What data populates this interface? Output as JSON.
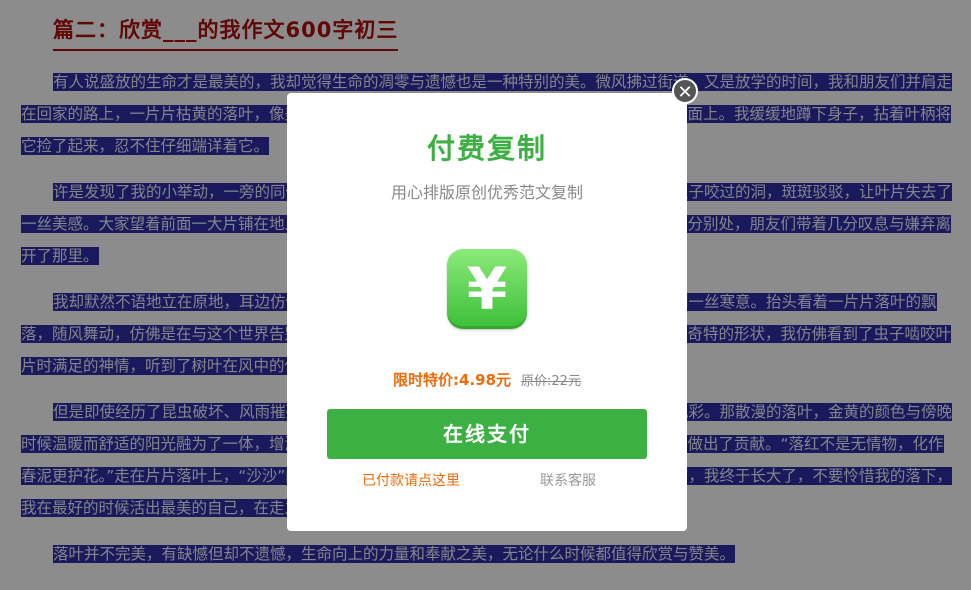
{
  "article": {
    "title": "篇二：欣赏___的我作文600字初三",
    "paragraphs": [
      "有人说盛放的生命才是最美的，我却觉得生命的凋零与遗憾也是一种特别的美。微风拂过街道，又是放学的时间，我和朋友们并肩走在回家的路上，一片片枯黄的落叶，像美丽的蝴蝶一样在空中翩翩起舞，然后轻轻地落在了我的鞋面上。我缓缓地蹲下身子，拈着叶柄将它捡了起来，忍不住仔细端详着它。",
      "许是发现了我的小举动，一旁的同伴们也纷纷凑了过来。只见叶片上布满了大大小小的、被虫子咬过的洞，斑斑驳驳，让叶片失去了一丝美感。大家望着前面一大片铺在地上的落叶，纷纷摇头叹息，说这些落叶真是太可惜了。走到分别处，朋友们带着几分叹息与嫌弃离开了那里。",
      "我却默然不语地立在原地，耳边仿佛又响起了秋风吹过的声音，带着几分凉意，让人不禁感到一丝寒意。抬头看着一片片落叶的飘落，随风舞动，仿佛是在与这个世界告别。我低下头，细细观察着手中的这片落叶，看着那些孔洞奇特的形状，我仿佛看到了虫子啮咬叶片时满足的神情，听到了树叶在风中的低语。",
      "但是即使经历了昆虫破坏、风雨摧残，它依然坚持着自己的使命，为大地带来了一抹别样的色彩。那散漫的落叶，金黄的颜色与傍晚时候温暖而舒适的阳光融为了一体，增添了一份秋天独有的韵味。它们用自己最后的生命为大自然做出了贡献。“落红不是无情物，化作春泥更护花。”走在片片落叶上，“沙沙”的声响仿佛是它们在对我说话，对我说：不要为我感到悲伤，我终于长大了，不要怜惜我的落下，我在最好的时候活出最美的自己，在走之前为这个世界留下了最后的美丽。",
      "落叶并不完美，有缺憾但却不遗憾，生命向上的力量和奉献之美，无论什么时候都值得欣赏与赞美。"
    ]
  },
  "modal": {
    "close_symbol": "✕",
    "title": "付费复制",
    "subtitle": "用心排版原创优秀范文复制",
    "icon_symbol": "¥",
    "icon": "yen-icon",
    "price_label": "限时特价:",
    "price_value": "4.98元",
    "original_price": "原价:22元",
    "pay_button": "在线支付",
    "paid_link": "已付款请点这里",
    "service_link": "联系客服"
  },
  "colors": {
    "accent_green": "#3cb043",
    "price_orange": "#f06a0a",
    "title_red": "#b01010",
    "highlight_blue": "#2f2fa8"
  }
}
